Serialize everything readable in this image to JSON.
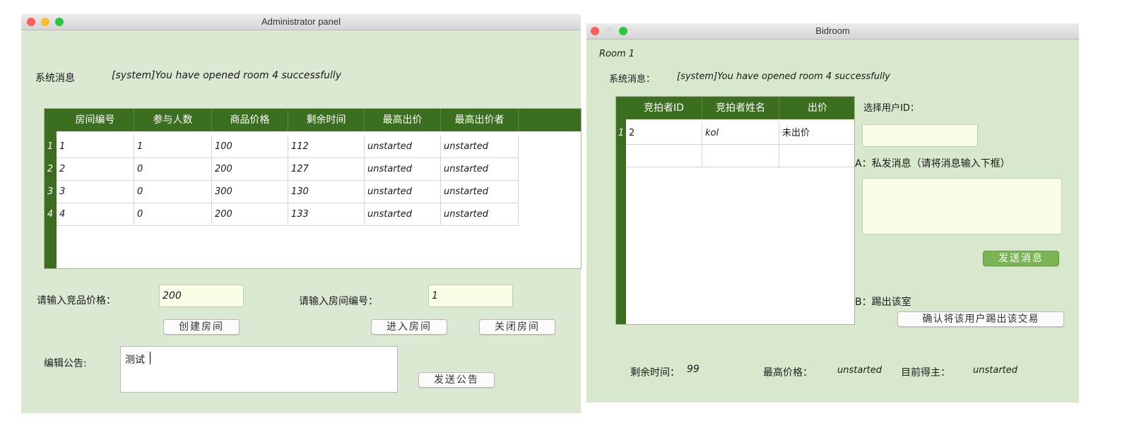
{
  "admin": {
    "title": "Administrator panel",
    "system_label": "系统消息",
    "system_message": "[system]You have opened room 4 successfully",
    "table": {
      "headers": [
        "房间编号",
        "参与人数",
        "商品价格",
        "剩余时间",
        "最高出价",
        "最高出价者"
      ],
      "row_numbers": [
        "1",
        "2",
        "3",
        "4"
      ],
      "rows": [
        [
          "1",
          "1",
          "100",
          "112",
          "unstarted",
          "unstarted"
        ],
        [
          "2",
          "0",
          "200",
          "127",
          "unstarted",
          "unstarted"
        ],
        [
          "3",
          "0",
          "300",
          "130",
          "unstarted",
          "unstarted"
        ],
        [
          "4",
          "0",
          "200",
          "133",
          "unstarted",
          "unstarted"
        ]
      ]
    },
    "price_label": "请输入竞品价格：",
    "price_value": "200",
    "room_no_label": "请输入房间编号：",
    "room_no_value": "1",
    "create_button": "创建房间",
    "enter_button": "进入房间",
    "close_button": "关闭房间",
    "notice_label": "编辑公告:",
    "notice_value": "测试",
    "send_notice_button": "发送公告"
  },
  "bidroom": {
    "title": "Bidroom",
    "room_label": "Room 1",
    "system_label": "系统消息：",
    "system_message": "[system]You have opened room 4 successfully",
    "table": {
      "headers": [
        "竞拍者ID",
        "竞拍者姓名",
        "出价"
      ],
      "row_numbers": [
        "1"
      ],
      "rows": [
        [
          "2",
          "kol",
          "未出价"
        ]
      ]
    },
    "select_user_label": "选择用户ID：",
    "select_user_value": "",
    "private_msg_label": "A：私发消息（请将消息输入下框）",
    "send_msg_button": "发送消息",
    "kick_label": "B：踢出该室",
    "kick_button": "确认将该用户踢出该交易",
    "time_left_label": "剩余时间：",
    "time_left_value": "99",
    "top_price_label": "最高价格：",
    "top_price_value": "unstarted",
    "current_owner_label": "目前得主：",
    "current_owner_value": "unstarted"
  },
  "colors": {
    "window_bg": "#dbe8d2",
    "header_green": "#3c6e1f",
    "field_bg": "#f9ffe6",
    "close_red": "#fc5f57",
    "minimize_yellow": "#fdbc2e",
    "zoom_green": "#28c840"
  },
  "icons": [
    "close-icon",
    "minimize-icon",
    "zoom-icon"
  ]
}
